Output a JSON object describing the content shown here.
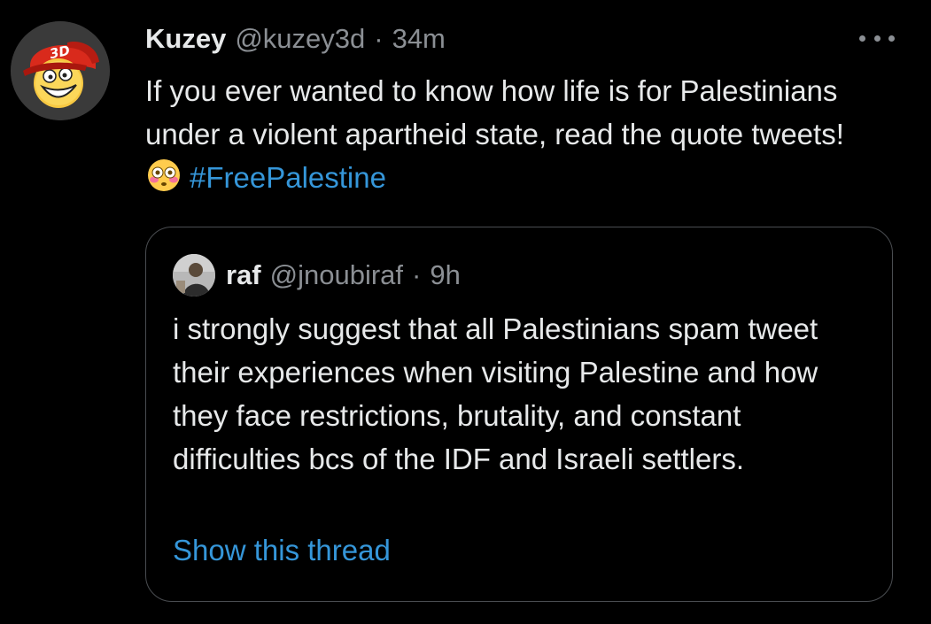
{
  "tweet": {
    "author_name": "Kuzey",
    "author_handle": "@kuzey3d",
    "separator": "·",
    "time": "34m",
    "text_before_emoji": "If you ever wanted to know how life is for Palestinians under a violent apartheid state, read the quote tweets!",
    "emoji": "flushed-face-emoji",
    "hashtag": "#FreePalestine",
    "avatar_text": "3D",
    "more_icon": "more-dots-icon"
  },
  "quote": {
    "author_name": "raf",
    "author_handle": "@jnoubiraf",
    "separator": "·",
    "time": "9h",
    "text": "i strongly suggest that all Palestinians spam tweet their experiences when visiting Palestine and how they face restrictions, brutality, and constant difficulties bcs of the IDF and Israeli settlers.",
    "show_thread_label": "Show this thread"
  },
  "colors": {
    "background": "#000000",
    "text": "#e7e9ea",
    "secondary": "#8b8f94",
    "link": "#3596d9",
    "border": "#4a4d51"
  }
}
